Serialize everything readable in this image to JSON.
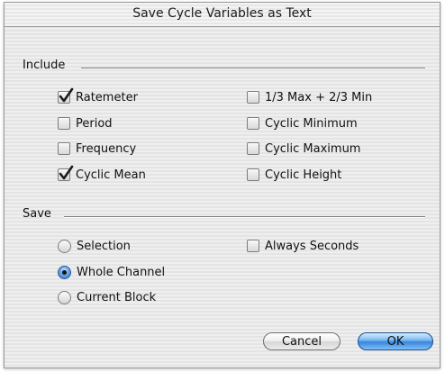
{
  "dialog": {
    "title": "Save Cycle Variables as Text"
  },
  "include": {
    "label": "Include",
    "options": [
      {
        "label": "Ratemeter",
        "checked": true
      },
      {
        "label": "Period",
        "checked": false
      },
      {
        "label": "Frequency",
        "checked": false
      },
      {
        "label": "Cyclic Mean",
        "checked": true
      },
      {
        "label": "1/3 Max + 2/3 Min",
        "checked": false
      },
      {
        "label": "Cyclic Minimum",
        "checked": false
      },
      {
        "label": "Cyclic Maximum",
        "checked": false
      },
      {
        "label": "Cyclic Height",
        "checked": false
      }
    ]
  },
  "save": {
    "label": "Save",
    "radios": [
      {
        "label": "Selection",
        "selected": false
      },
      {
        "label": "Whole Channel",
        "selected": true
      },
      {
        "label": "Current Block",
        "selected": false
      }
    ],
    "always_seconds": {
      "label": "Always Seconds",
      "checked": false
    }
  },
  "buttons": {
    "cancel": "Cancel",
    "ok": "OK"
  },
  "colors": {
    "ok_blue": "#3a86dd",
    "check_dark": "#1b1b1b"
  }
}
